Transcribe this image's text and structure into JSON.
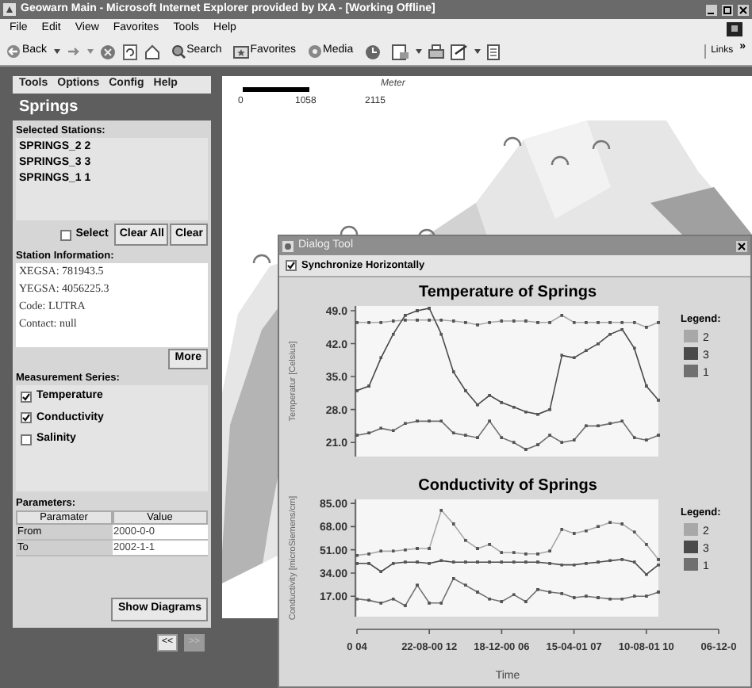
{
  "window": {
    "title": "Geowarn Main - Microsoft Internet Explorer provided by IXA - [Working Offline]"
  },
  "menu": [
    "File",
    "Edit",
    "View",
    "Favorites",
    "Tools",
    "Help"
  ],
  "toolbar": {
    "back": "Back",
    "search": "Search",
    "favorites": "Favorites",
    "media": "Media",
    "links": "Links",
    "more": "»"
  },
  "app_menu": [
    "Tools",
    "Options",
    "Config",
    "Help"
  ],
  "panel": {
    "title": "Springs",
    "selected_stations": {
      "label": "Selected Stations:",
      "items": [
        "SPRINGS_2 2",
        "SPRINGS_3 3",
        "SPRINGS_1 1"
      ]
    },
    "select": {
      "label": "Select",
      "checked": false
    },
    "buttons": [
      "Clear All",
      "Clear"
    ],
    "station_information": {
      "label": "Station Information:",
      "lines": [
        "XEGSA: 781943.5",
        "YEGSA: 4056225.3",
        "Code: LUTRA",
        "Contact: null"
      ]
    },
    "more_button": "More",
    "measurement_series": {
      "label": "Measurement Series:",
      "items": [
        {
          "label": "Temperature",
          "checked": true
        },
        {
          "label": "Conductivity",
          "checked": true
        },
        {
          "label": "Salinity",
          "checked": false
        }
      ]
    },
    "parameters": {
      "label": "Parameters:",
      "columns": [
        "Paramater",
        "Value"
      ],
      "rows": [
        [
          "From",
          "2000-0-0"
        ],
        [
          "To",
          "2002-1-1"
        ]
      ]
    },
    "show_button": "Show Diagrams"
  },
  "pager": [
    {
      "label": "<<",
      "disabled": false
    },
    {
      "label": ">>",
      "disabled": true
    }
  ],
  "map": {
    "scale": {
      "unit": "Meter",
      "labels": [
        "0",
        "1058",
        "2115"
      ]
    }
  },
  "dialog": {
    "title": "Dialog Tool",
    "synchronize": {
      "label": "Synchronize Horizontally",
      "checked": true
    },
    "charts": [
      {
        "legend_title": "Legend:",
        "chart_data": {
          "type": "line",
          "title": "Temperature of Springs",
          "legend": "right",
          "ylabel": "Temperatur [Celsius]",
          "categories": [
            null,
            null,
            null,
            null,
            null,
            null,
            null,
            null,
            null,
            null,
            null,
            null,
            null,
            null,
            null,
            null,
            null,
            null,
            null,
            null,
            null,
            null,
            null,
            null,
            null,
            null,
            null,
            null,
            null,
            null,
            null
          ],
          "ylim": [
            18,
            50
          ],
          "yticks": [
            {
              "value": 21,
              "label": "21.0"
            },
            {
              "value": 28,
              "label": "28.0"
            },
            {
              "value": 35,
              "label": "35.0"
            },
            {
              "value": 42,
              "label": "42.0"
            },
            {
              "value": 49,
              "label": "49.0"
            }
          ],
          "series": [
            {
              "name": "2",
              "color": "#a8a8a8",
              "values": [
                46.5,
                46.5,
                46.5,
                46.8,
                47,
                47,
                47,
                47,
                46.8,
                46.5,
                46,
                46.5,
                46.8,
                46.8,
                46.8,
                46.5,
                46.5,
                48,
                46.5,
                46.5,
                46.5,
                46.5,
                46.5,
                46.5,
                45.5,
                46.5,
                null,
                null,
                null,
                null,
                null
              ]
            },
            {
              "name": "3",
              "color": "#4a4a4a",
              "values": [
                32,
                33,
                39,
                44,
                48,
                49,
                49.5,
                44,
                36,
                32,
                29,
                31,
                29.5,
                28.5,
                27.5,
                27,
                28,
                39.5,
                39,
                40.5,
                42,
                44,
                45,
                41,
                33,
                30,
                null,
                null,
                null,
                null,
                null
              ]
            },
            {
              "name": "1",
              "color": "#707070",
              "values": [
                22.5,
                23,
                24,
                23.5,
                25,
                25.5,
                25.5,
                25.5,
                23,
                22.5,
                22,
                25.5,
                22,
                21,
                19.5,
                20.5,
                22.5,
                21,
                21.5,
                24.5,
                24.5,
                25,
                25.5,
                22,
                21.5,
                22.5,
                null,
                null,
                null,
                null,
                null
              ]
            }
          ]
        }
      },
      {
        "legend_title": "Legend:",
        "chart_data": {
          "type": "line",
          "title": "Conductivity of Springs",
          "legend": "right",
          "xlabel": "Time",
          "ylabel": "Conductivity [microSiemens/cm]",
          "categories": [
            "0 04",
            null,
            null,
            null,
            null,
            null,
            "22-08-00 12",
            null,
            null,
            null,
            null,
            null,
            "18-12-00 06",
            null,
            null,
            null,
            null,
            null,
            "15-04-01 07",
            null,
            null,
            null,
            null,
            null,
            "10-08-01 10",
            null,
            null,
            null,
            null,
            null,
            "06-12-0"
          ],
          "ylim": [
            2,
            88
          ],
          "yticks": [
            {
              "value": 17,
              "label": "17.00"
            },
            {
              "value": 34,
              "label": "34.00"
            },
            {
              "value": 51,
              "label": "51.00"
            },
            {
              "value": 68,
              "label": "68.00"
            },
            {
              "value": 85,
              "label": "85.00"
            }
          ],
          "series": [
            {
              "name": "2",
              "color": "#a8a8a8",
              "values": [
                47,
                48,
                50,
                50,
                51,
                52,
                52,
                80,
                70,
                58,
                52,
                55,
                49,
                49,
                48,
                48,
                50,
                66,
                63,
                65,
                68,
                71,
                70,
                64,
                55,
                44,
                null,
                null,
                null,
                null,
                null
              ]
            },
            {
              "name": "3",
              "color": "#4a4a4a",
              "values": [
                41,
                41,
                35,
                41,
                42,
                42,
                41,
                43,
                42,
                42,
                42,
                42,
                42,
                42,
                42,
                42,
                41,
                40,
                40,
                41,
                42,
                43,
                44,
                42,
                33,
                40,
                null,
                null,
                null,
                null,
                null
              ]
            },
            {
              "name": "1",
              "color": "#707070",
              "values": [
                15,
                14,
                12,
                15,
                10,
                25,
                12,
                12,
                30,
                25,
                20,
                15,
                13,
                18,
                13,
                22,
                20,
                19,
                16,
                17,
                16,
                15,
                15,
                17,
                17,
                20,
                null,
                null,
                null,
                null,
                null
              ]
            }
          ]
        }
      }
    ]
  }
}
